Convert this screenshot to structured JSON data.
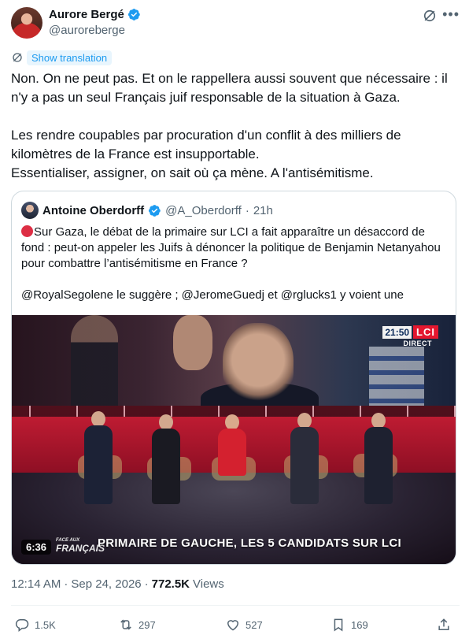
{
  "author": {
    "name": "Aurore Bergé",
    "handle": "@auroreberge"
  },
  "translate": {
    "label": "Show translation"
  },
  "tweet": {
    "text": "Non. On ne peut pas. Et on le rappellera aussi souvent que nécessaire : il n'y a pas un seul Français juif responsable de la situation à Gaza.\n\nLes rendre coupables par procuration d'un conflit à des milliers de kilomètres de la France est insupportable.\nEssentialiser, assigner, on sait où ça mène. A l'antisémitisme."
  },
  "quote": {
    "name": "Antoine Oberdorff",
    "handle": "@A_Oberdorff",
    "separator": "·",
    "time": "21h",
    "para1": "Sur Gaza, le débat de la primaire sur LCI a fait apparaître un désaccord de fond : peut-on appeler les Juifs à dénoncer la politique de Benjamin Netanyahou pour combattre l’antisémitisme en France ?",
    "para2": "@RoyalSegolene le suggère ; @JeromeGuedj et @rglucks1 y voient une",
    "video": {
      "clock": "21:50",
      "channel": "LCI",
      "live_label": "DIRECT",
      "duration": "6:36",
      "watermark_line1": "FACE AUX",
      "watermark_line2": "FRANÇAIS",
      "caption": "PRIMAIRE DE GAUCHE, LES 5 CANDIDATS SUR LCI"
    }
  },
  "meta": {
    "time": "12:14 AM",
    "separator": "·",
    "date": "Sep 24, 2026",
    "separator2": "·",
    "views_count": "772.5K",
    "views_label": "Views"
  },
  "actions": {
    "replies": "1.5K",
    "reposts": "297",
    "likes": "527",
    "bookmarks": "169"
  },
  "icons": [
    "verified-badge-icon",
    "grok-icon",
    "more-icon",
    "globe-icon",
    "reply-icon",
    "repost-icon",
    "like-icon",
    "bookmark-icon",
    "share-icon"
  ],
  "colors": {
    "accent": "#1d9bf0",
    "text": "#0f1419",
    "secondary": "#536471",
    "border": "#cfd9de"
  }
}
